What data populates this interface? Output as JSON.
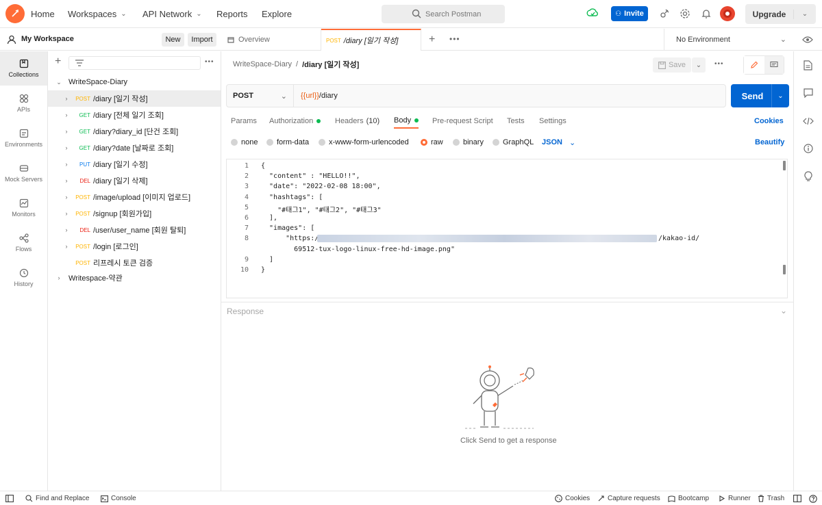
{
  "topbar": {
    "nav": [
      "Home",
      "Workspaces",
      "API Network",
      "Reports",
      "Explore"
    ],
    "search_placeholder": "Search Postman",
    "invite": "Invite",
    "upgrade": "Upgrade"
  },
  "workspace": {
    "name": "My Workspace",
    "new_label": "New",
    "import_label": "Import"
  },
  "tabs": {
    "overview": "Overview",
    "active_method": "POST",
    "active_name": "/diary [일기 작성]",
    "environment": "No Environment"
  },
  "rail": [
    "Collections",
    "APIs",
    "Environments",
    "Mock Servers",
    "Monitors",
    "Flows",
    "History"
  ],
  "tree": {
    "collection": "WriteSpace-Diary",
    "items": [
      {
        "method": "POST",
        "name": "/diary [일기 작성]"
      },
      {
        "method": "GET",
        "name": "/diary [전체 일기 조회]"
      },
      {
        "method": "GET",
        "name": "/diary?diary_id [단건 조회]"
      },
      {
        "method": "GET",
        "name": "/diary?date [날짜로 조회]"
      },
      {
        "method": "PUT",
        "name": "/diary [일기 수정]"
      },
      {
        "method": "DEL",
        "name": "/diary [일기 삭제]"
      },
      {
        "method": "POST",
        "name": "/image/upload [이미지 업로드]"
      },
      {
        "method": "POST",
        "name": "/signup [회원가입]"
      },
      {
        "method": "DEL",
        "name": "/user/user_name [회원 탈퇴]"
      },
      {
        "method": "POST",
        "name": "/login [로그인]"
      },
      {
        "method": "POST",
        "name": "리프레시 토큰 검증"
      }
    ],
    "collection2": "Writespace-약관"
  },
  "request": {
    "breadcrumb_parent": "WriteSpace-Diary",
    "breadcrumb_sep": "/",
    "breadcrumb_current": "/diary [일기 작성]",
    "save": "Save",
    "method": "POST",
    "url_var": "{{url}}",
    "url_path": "/diary",
    "send": "Send"
  },
  "req_tabs": {
    "params": "Params",
    "authorization": "Authorization",
    "headers": "Headers",
    "headers_count": "(10)",
    "body": "Body",
    "prerequest": "Pre-request Script",
    "tests": "Tests",
    "settings": "Settings",
    "cookies": "Cookies"
  },
  "body_types": {
    "none": "none",
    "form_data": "form-data",
    "urlencoded": "x-www-form-urlencoded",
    "raw": "raw",
    "binary": "binary",
    "graphql": "GraphQL",
    "format": "JSON",
    "beautify": "Beautify"
  },
  "editor": {
    "line_numbers": [
      "1",
      "2",
      "3",
      "4",
      "5",
      "6",
      "7",
      "8",
      "",
      "9",
      "10"
    ],
    "lines": [
      "{",
      "  \"content\" : \"HELLO!!\",",
      "  \"date\": \"2022-02-08 18:00\",",
      "  \"hashtags\": [",
      "    \"#태그1\", \"#태그2\", \"#태그3\"",
      "  ],",
      "  \"images\": [",
      "      \"https://",
      "        69512-tux-logo-linux-free-hd-image.png\"",
      "  ]",
      "}"
    ],
    "line8_tail": "/kakao-id/"
  },
  "response": {
    "label": "Response",
    "empty_text": "Click Send to get a response"
  },
  "status": {
    "find_replace": "Find and Replace",
    "console": "Console",
    "cookies": "Cookies",
    "capture": "Capture requests",
    "bootcamp": "Bootcamp",
    "runner": "Runner",
    "trash": "Trash"
  }
}
